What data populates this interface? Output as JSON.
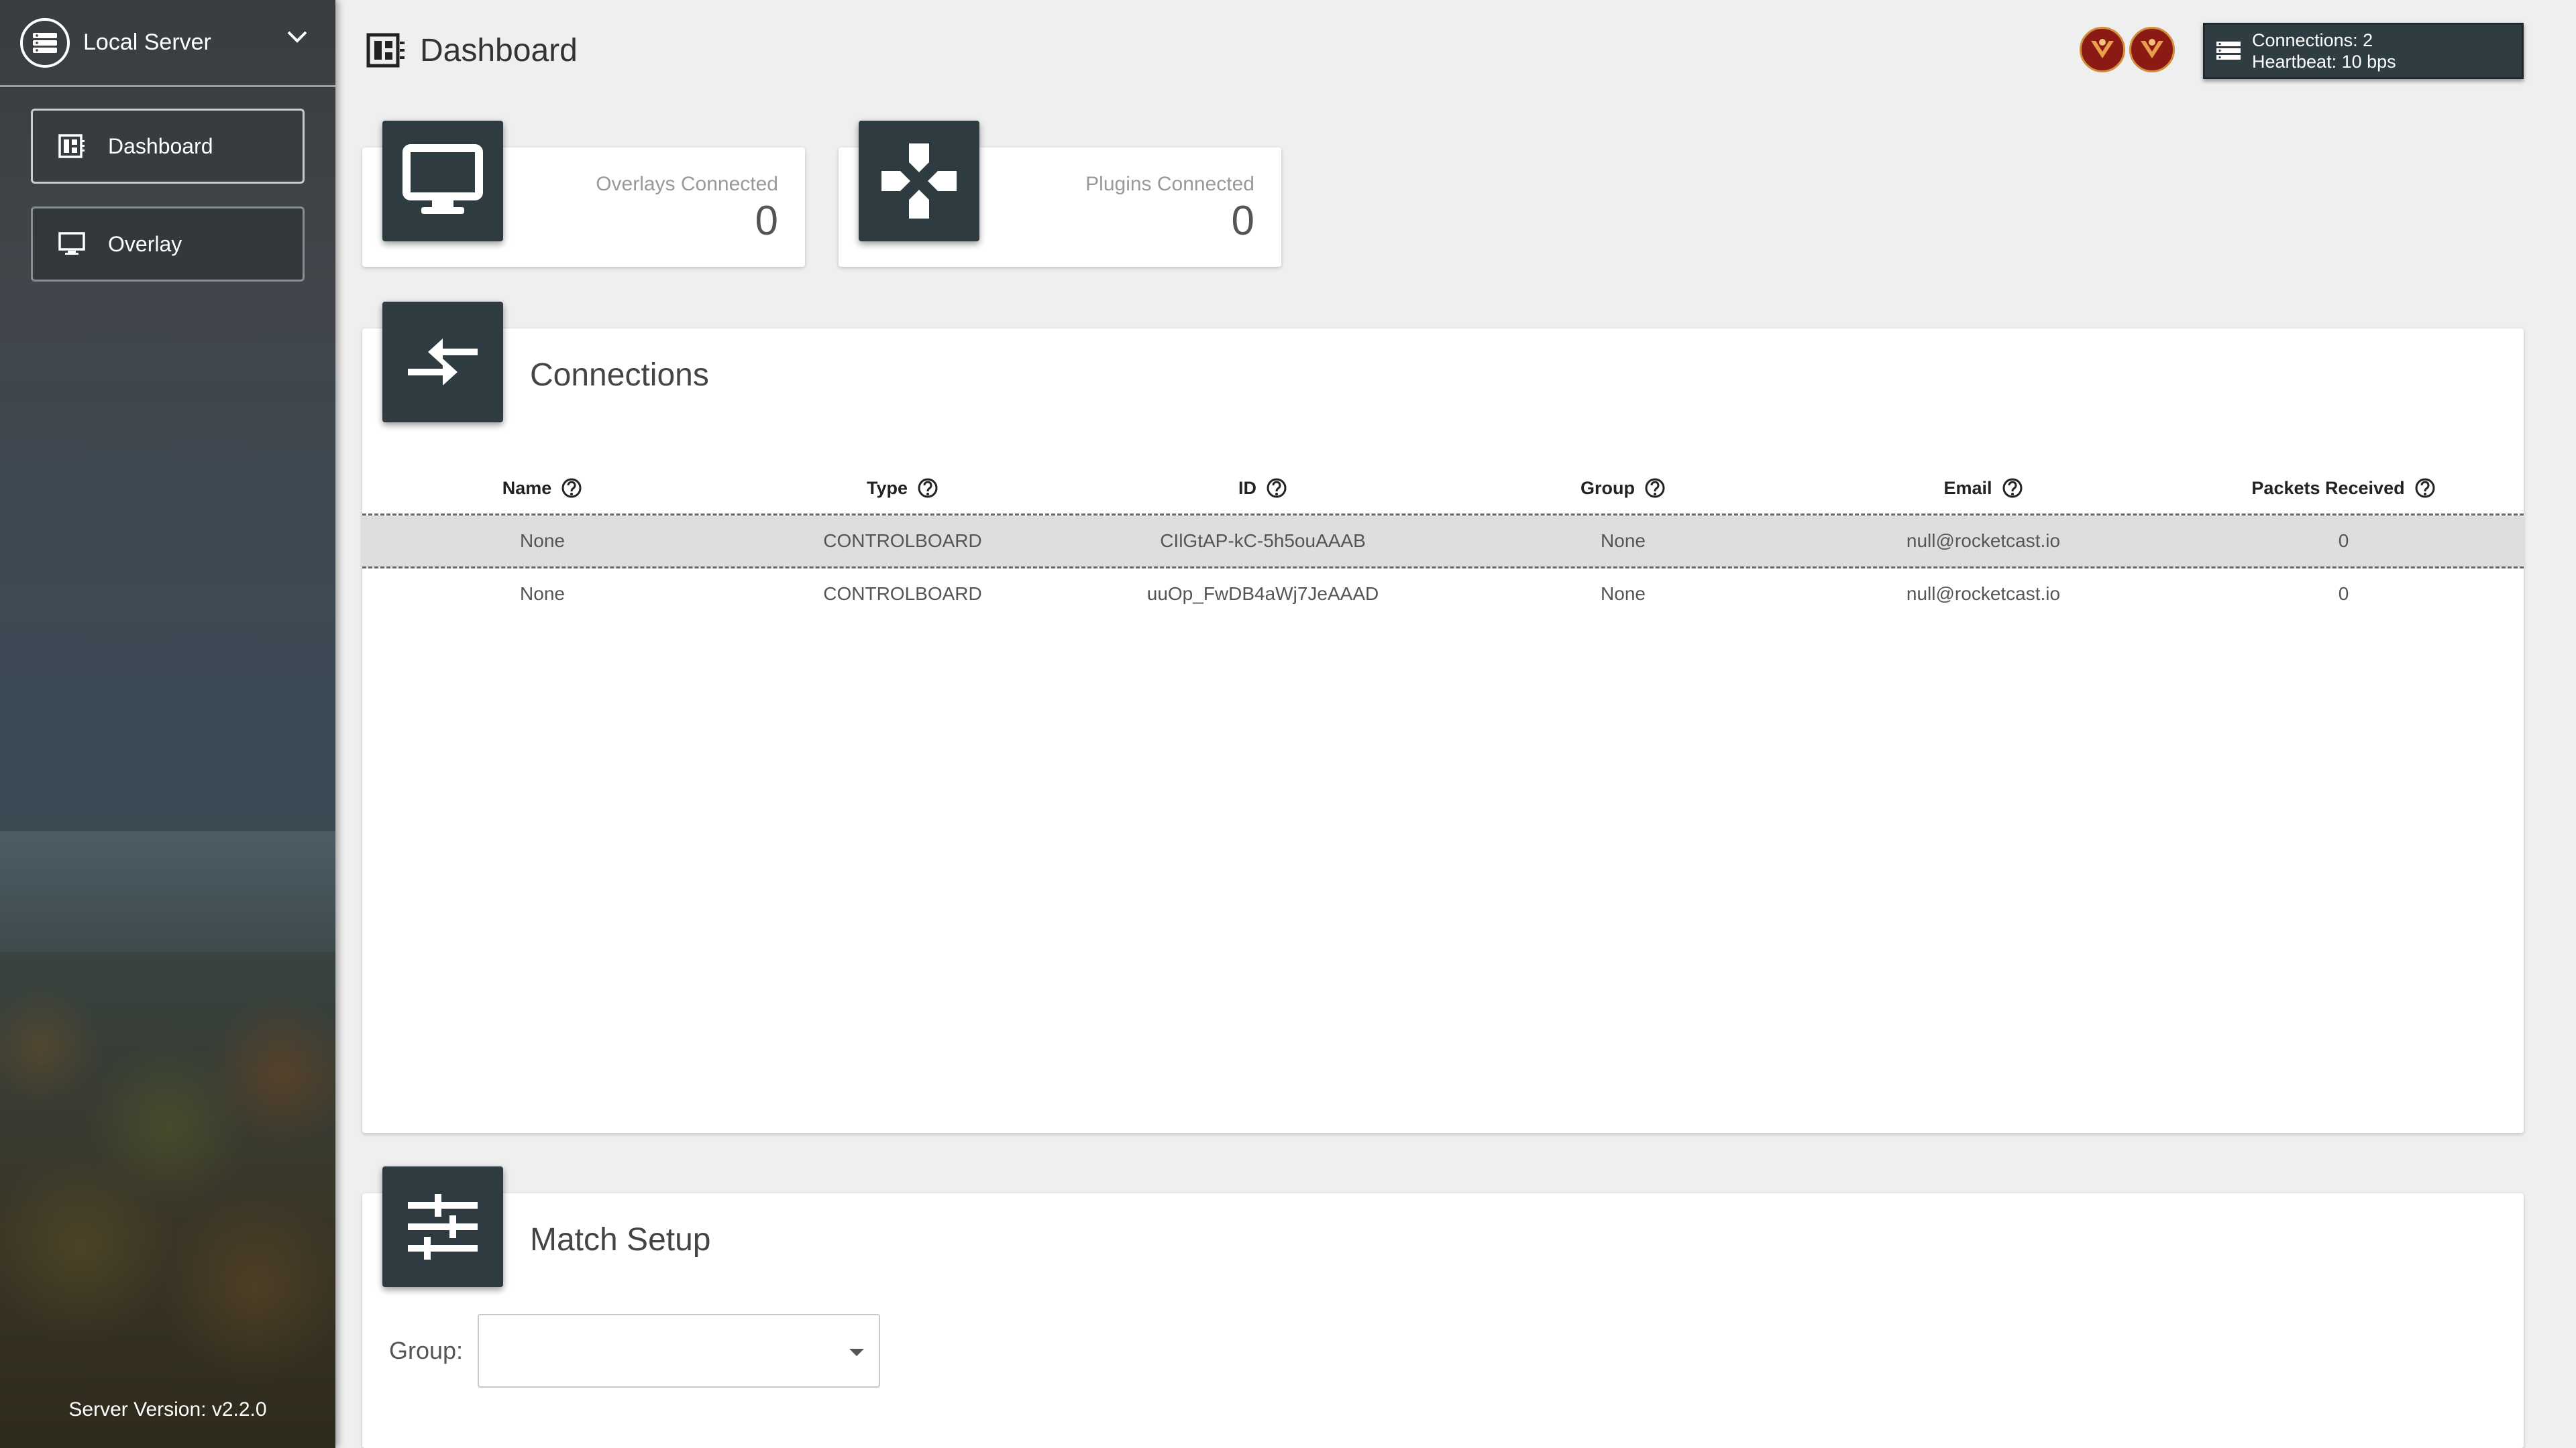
{
  "sidebar": {
    "server_label": "Local Server",
    "items": [
      {
        "label": "Dashboard",
        "icon": "dashboard-icon",
        "active": true
      },
      {
        "label": "Overlay",
        "icon": "monitor-icon",
        "active": false
      }
    ],
    "server_version": "Server Version: v2.2.0"
  },
  "header": {
    "title": "Dashboard",
    "status": {
      "connections": "Connections: 2",
      "heartbeat": "Heartbeat: 10 bps"
    }
  },
  "stats": {
    "overlays": {
      "label": "Overlays Connected",
      "value": "0"
    },
    "plugins": {
      "label": "Plugins Connected",
      "value": "0"
    }
  },
  "connections": {
    "title": "Connections",
    "columns": [
      "Name",
      "Type",
      "ID",
      "Group",
      "Email",
      "Packets Received"
    ],
    "rows": [
      [
        "None",
        "CONTROLBOARD",
        "CIlGtAP-kC-5h5ouAAAB",
        "None",
        "null@rocketcast.io",
        "0"
      ],
      [
        "None",
        "CONTROLBOARD",
        "uuOp_FwDB4aWj7JeAAAD",
        "None",
        "null@rocketcast.io",
        "0"
      ]
    ]
  },
  "match_setup": {
    "title": "Match Setup",
    "group_label": "Group:",
    "group_value": ""
  },
  "colors": {
    "tile": "#2e3b40",
    "background": "#efefef",
    "status_box": "#2f3d42"
  }
}
